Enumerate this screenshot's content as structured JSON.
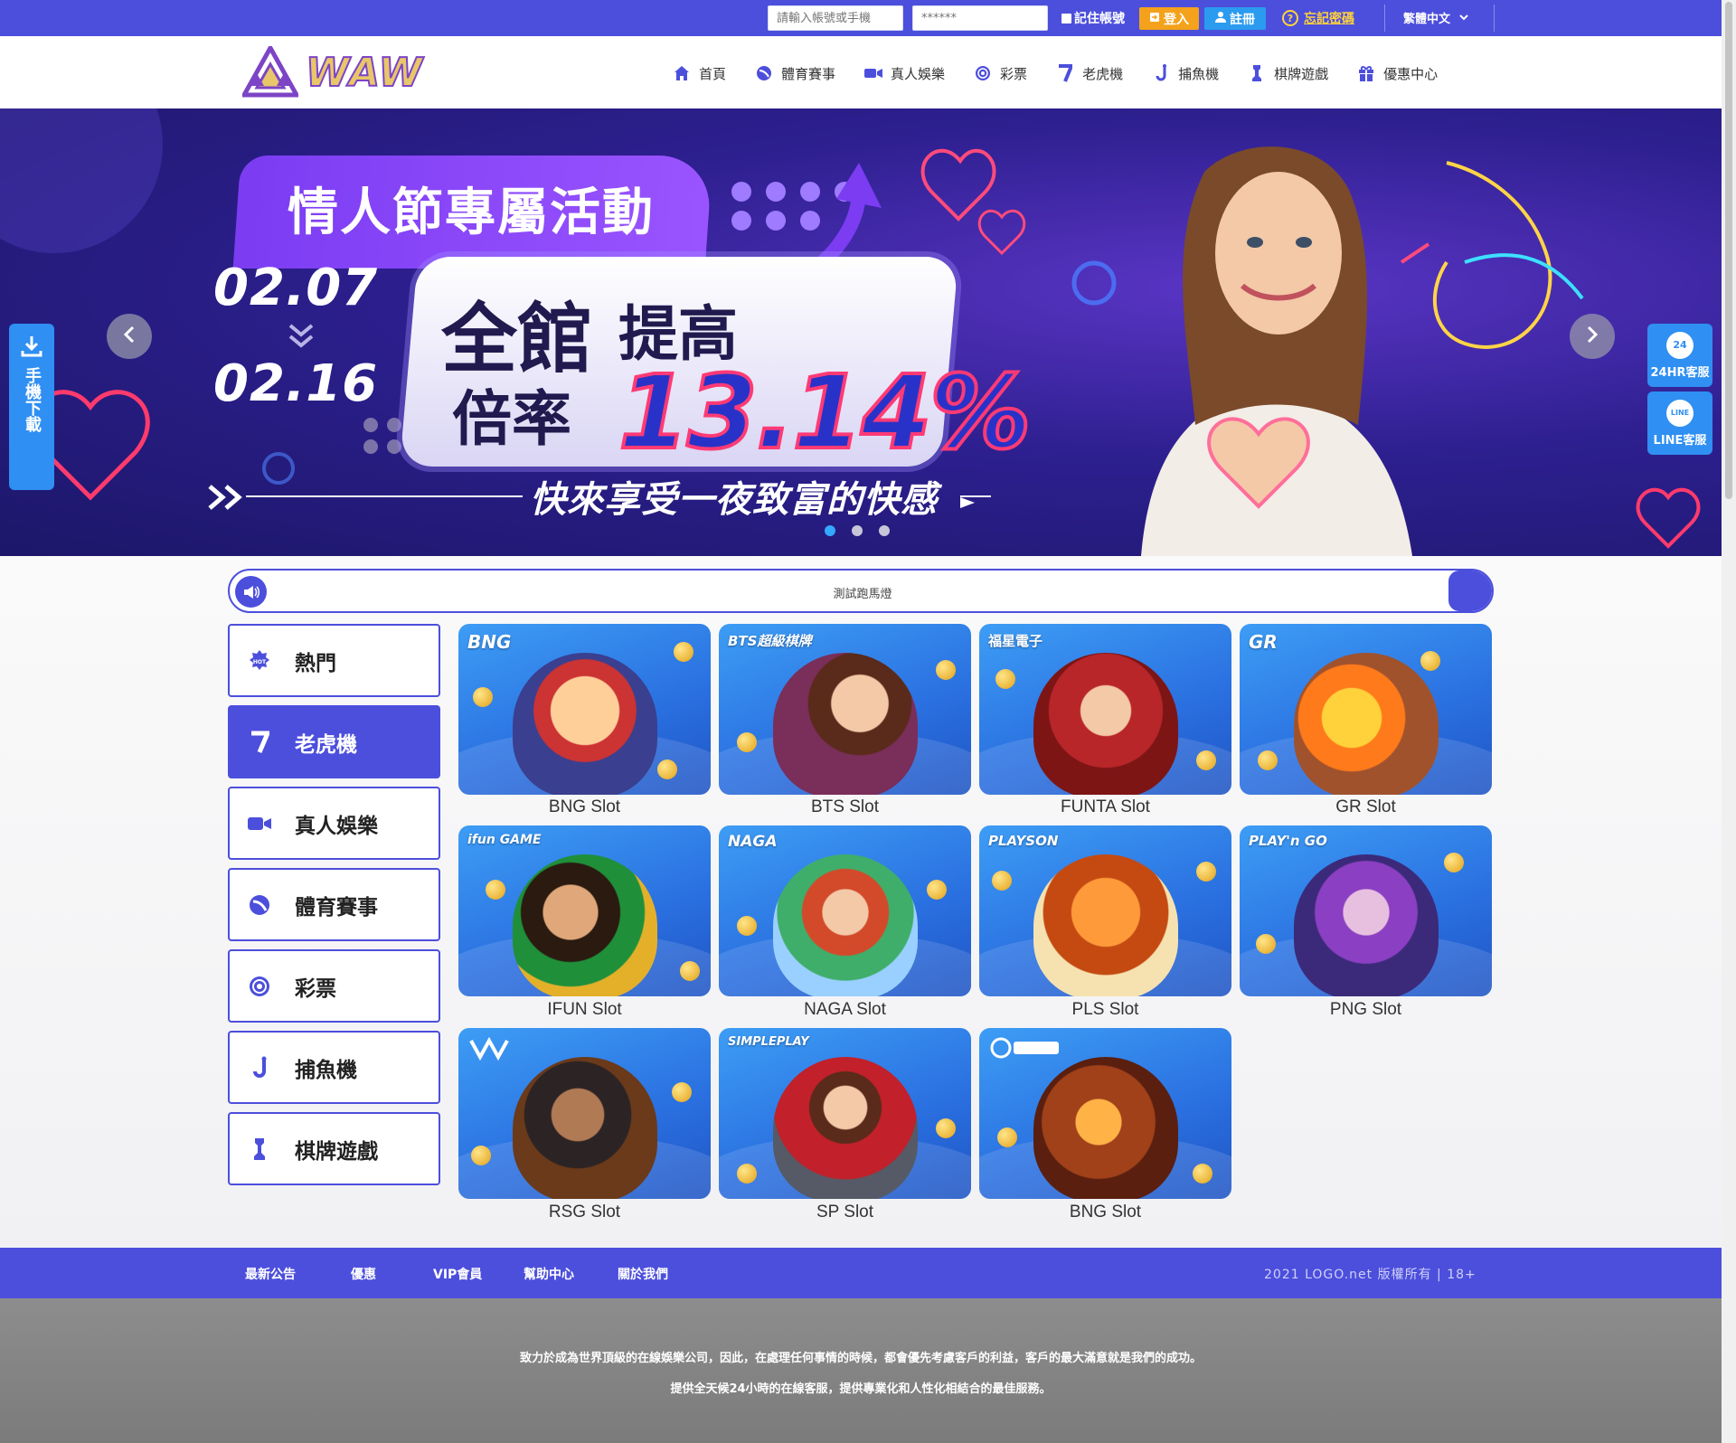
{
  "topbar": {
    "account_placeholder": "請輸入帳號或手機",
    "password_placeholder": "******",
    "remember_label": "記住帳號",
    "login_label": "登入",
    "register_label": "註冊",
    "forgot_label": "忘記密碼",
    "language_label": "繁體中文"
  },
  "header": {
    "logo_text": "WAW",
    "nav": [
      {
        "label": "首頁",
        "icon": "home-icon"
      },
      {
        "label": "體育賽事",
        "icon": "sports-icon"
      },
      {
        "label": "真人娛樂",
        "icon": "video-icon"
      },
      {
        "label": "彩票",
        "icon": "lottery-icon"
      },
      {
        "label": "老虎機",
        "icon": "slot-seven-icon"
      },
      {
        "label": "捕魚機",
        "icon": "fish-hook-icon"
      },
      {
        "label": "棋牌遊戲",
        "icon": "chess-icon"
      },
      {
        "label": "優惠中心",
        "icon": "gift-icon"
      }
    ]
  },
  "banner": {
    "title": "情人節專屬活動",
    "date_start": "02.07",
    "date_end": "02.16",
    "line1_big": "全館",
    "line1_small": "提高",
    "line2_big": "倍率",
    "rate": "13.14%",
    "slogan": "快來享受一夜致富的快感",
    "slide_count": 3,
    "active_slide": 1
  },
  "side": {
    "download_label": "手機下載",
    "cs24_label": "24HR客服",
    "cs24_badge": "24",
    "line_label": "LINE客服",
    "line_badge": "LINE"
  },
  "marquee": {
    "text": "測試跑馬燈"
  },
  "categories": [
    {
      "label": "熱門",
      "icon": "hot-icon",
      "active": false
    },
    {
      "label": "老虎機",
      "icon": "slot-seven-icon",
      "active": true
    },
    {
      "label": "真人娛樂",
      "icon": "video-icon",
      "active": false
    },
    {
      "label": "體育賽事",
      "icon": "sports-icon",
      "active": false
    },
    {
      "label": "彩票",
      "icon": "lottery-icon",
      "active": false
    },
    {
      "label": "捕魚機",
      "icon": "fish-hook-icon",
      "active": false
    },
    {
      "label": "棋牌遊戲",
      "icon": "chess-icon",
      "active": false
    }
  ],
  "games": [
    {
      "name": "BNG Slot",
      "brand": "BNG"
    },
    {
      "name": "BTS Slot",
      "brand": "BTS超級棋牌"
    },
    {
      "name": "FUNTA Slot",
      "brand": "福星電子"
    },
    {
      "name": "GR Slot",
      "brand": "GR"
    },
    {
      "name": "IFUN Slot",
      "brand": "ifun GAME"
    },
    {
      "name": "NAGA Slot",
      "brand": "NAGA"
    },
    {
      "name": "PLS Slot",
      "brand": "PLAYSON"
    },
    {
      "name": "PNG Slot",
      "brand": "PLAY'n GO"
    },
    {
      "name": "RSG Slot",
      "brand": ""
    },
    {
      "name": "SP Slot",
      "brand": "SIMPLEPLAY"
    },
    {
      "name": "BNG Slot",
      "brand": ""
    }
  ],
  "footer": {
    "nav": [
      "最新公告",
      "優惠",
      "VIP會員",
      "幫助中心",
      "關於我們"
    ],
    "copyright": "2021 LOGO.net 版權所有 | 18+",
    "line1": "致力於成為世界頂級的在線娛樂公司，因此，在處理任何事情的時候，都會優先考慮客戶的利益，客戶的最大滿意就是我們的成功。",
    "line2": "提供全天候24小時的在線客服，提供專業化和人性化相結合的最佳服務。"
  },
  "colors": {
    "primary": "#4c4fdc",
    "login": "#f4a21b",
    "register": "#2b9bf0",
    "forgot": "#ffd23b",
    "side_buttons": "#2f8ff2"
  }
}
